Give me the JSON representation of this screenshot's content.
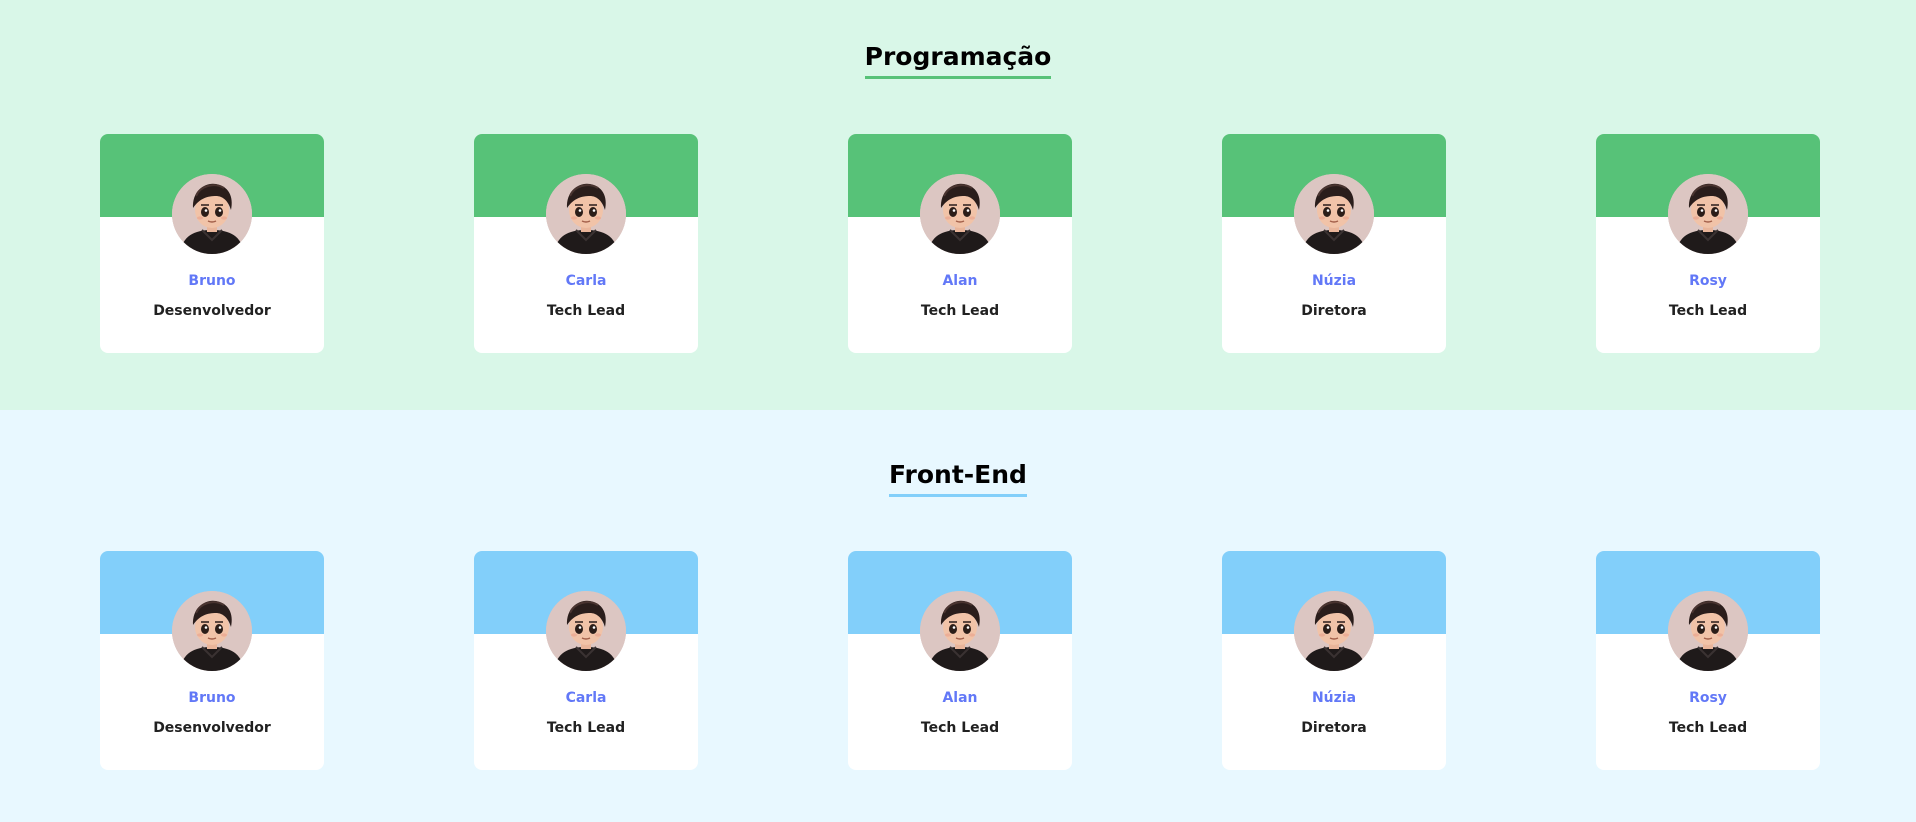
{
  "sections": [
    {
      "title": "Programação",
      "background": "#d9f7e8",
      "accent": "#57c278",
      "members": [
        {
          "name": "Bruno",
          "role": "Desenvolvedor",
          "avatar_icon": "avatar-cartoon-boy"
        },
        {
          "name": "Carla",
          "role": "Tech Lead",
          "avatar_icon": "avatar-cartoon-boy"
        },
        {
          "name": "Alan",
          "role": "Tech Lead",
          "avatar_icon": "avatar-cartoon-boy"
        },
        {
          "name": "Núzia",
          "role": "Diretora",
          "avatar_icon": "avatar-cartoon-boy"
        },
        {
          "name": "Rosy",
          "role": "Tech Lead",
          "avatar_icon": "avatar-cartoon-boy"
        }
      ]
    },
    {
      "title": "Front-End",
      "background": "#e8f8ff",
      "accent": "#82cffa",
      "members": [
        {
          "name": "Bruno",
          "role": "Desenvolvedor",
          "avatar_icon": "avatar-cartoon-boy"
        },
        {
          "name": "Carla",
          "role": "Tech Lead",
          "avatar_icon": "avatar-cartoon-boy"
        },
        {
          "name": "Alan",
          "role": "Tech Lead",
          "avatar_icon": "avatar-cartoon-boy"
        },
        {
          "name": "Núzia",
          "role": "Diretora",
          "avatar_icon": "avatar-cartoon-boy"
        },
        {
          "name": "Rosy",
          "role": "Tech Lead",
          "avatar_icon": "avatar-cartoon-boy"
        }
      ]
    }
  ],
  "colors": {
    "name_text": "#6278f7",
    "role_text": "#212121",
    "card_bg": "#ffffff"
  }
}
